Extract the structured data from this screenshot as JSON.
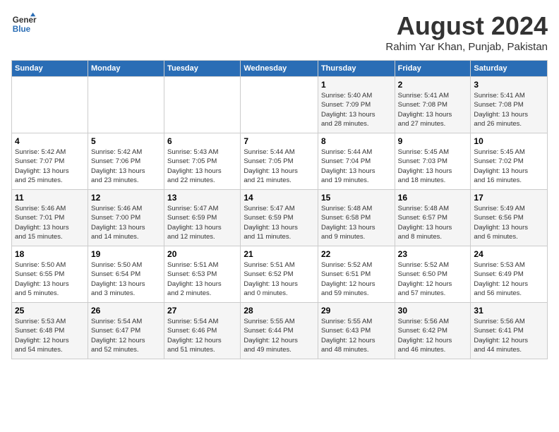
{
  "header": {
    "logo_line1": "General",
    "logo_line2": "Blue",
    "month_year": "August 2024",
    "location": "Rahim Yar Khan, Punjab, Pakistan"
  },
  "weekdays": [
    "Sunday",
    "Monday",
    "Tuesday",
    "Wednesday",
    "Thursday",
    "Friday",
    "Saturday"
  ],
  "weeks": [
    [
      {
        "day": "",
        "info": ""
      },
      {
        "day": "",
        "info": ""
      },
      {
        "day": "",
        "info": ""
      },
      {
        "day": "",
        "info": ""
      },
      {
        "day": "1",
        "info": "Sunrise: 5:40 AM\nSunset: 7:09 PM\nDaylight: 13 hours\nand 28 minutes."
      },
      {
        "day": "2",
        "info": "Sunrise: 5:41 AM\nSunset: 7:08 PM\nDaylight: 13 hours\nand 27 minutes."
      },
      {
        "day": "3",
        "info": "Sunrise: 5:41 AM\nSunset: 7:08 PM\nDaylight: 13 hours\nand 26 minutes."
      }
    ],
    [
      {
        "day": "4",
        "info": "Sunrise: 5:42 AM\nSunset: 7:07 PM\nDaylight: 13 hours\nand 25 minutes."
      },
      {
        "day": "5",
        "info": "Sunrise: 5:42 AM\nSunset: 7:06 PM\nDaylight: 13 hours\nand 23 minutes."
      },
      {
        "day": "6",
        "info": "Sunrise: 5:43 AM\nSunset: 7:05 PM\nDaylight: 13 hours\nand 22 minutes."
      },
      {
        "day": "7",
        "info": "Sunrise: 5:44 AM\nSunset: 7:05 PM\nDaylight: 13 hours\nand 21 minutes."
      },
      {
        "day": "8",
        "info": "Sunrise: 5:44 AM\nSunset: 7:04 PM\nDaylight: 13 hours\nand 19 minutes."
      },
      {
        "day": "9",
        "info": "Sunrise: 5:45 AM\nSunset: 7:03 PM\nDaylight: 13 hours\nand 18 minutes."
      },
      {
        "day": "10",
        "info": "Sunrise: 5:45 AM\nSunset: 7:02 PM\nDaylight: 13 hours\nand 16 minutes."
      }
    ],
    [
      {
        "day": "11",
        "info": "Sunrise: 5:46 AM\nSunset: 7:01 PM\nDaylight: 13 hours\nand 15 minutes."
      },
      {
        "day": "12",
        "info": "Sunrise: 5:46 AM\nSunset: 7:00 PM\nDaylight: 13 hours\nand 14 minutes."
      },
      {
        "day": "13",
        "info": "Sunrise: 5:47 AM\nSunset: 6:59 PM\nDaylight: 13 hours\nand 12 minutes."
      },
      {
        "day": "14",
        "info": "Sunrise: 5:47 AM\nSunset: 6:59 PM\nDaylight: 13 hours\nand 11 minutes."
      },
      {
        "day": "15",
        "info": "Sunrise: 5:48 AM\nSunset: 6:58 PM\nDaylight: 13 hours\nand 9 minutes."
      },
      {
        "day": "16",
        "info": "Sunrise: 5:48 AM\nSunset: 6:57 PM\nDaylight: 13 hours\nand 8 minutes."
      },
      {
        "day": "17",
        "info": "Sunrise: 5:49 AM\nSunset: 6:56 PM\nDaylight: 13 hours\nand 6 minutes."
      }
    ],
    [
      {
        "day": "18",
        "info": "Sunrise: 5:50 AM\nSunset: 6:55 PM\nDaylight: 13 hours\nand 5 minutes."
      },
      {
        "day": "19",
        "info": "Sunrise: 5:50 AM\nSunset: 6:54 PM\nDaylight: 13 hours\nand 3 minutes."
      },
      {
        "day": "20",
        "info": "Sunrise: 5:51 AM\nSunset: 6:53 PM\nDaylight: 13 hours\nand 2 minutes."
      },
      {
        "day": "21",
        "info": "Sunrise: 5:51 AM\nSunset: 6:52 PM\nDaylight: 13 hours\nand 0 minutes."
      },
      {
        "day": "22",
        "info": "Sunrise: 5:52 AM\nSunset: 6:51 PM\nDaylight: 12 hours\nand 59 minutes."
      },
      {
        "day": "23",
        "info": "Sunrise: 5:52 AM\nSunset: 6:50 PM\nDaylight: 12 hours\nand 57 minutes."
      },
      {
        "day": "24",
        "info": "Sunrise: 5:53 AM\nSunset: 6:49 PM\nDaylight: 12 hours\nand 56 minutes."
      }
    ],
    [
      {
        "day": "25",
        "info": "Sunrise: 5:53 AM\nSunset: 6:48 PM\nDaylight: 12 hours\nand 54 minutes."
      },
      {
        "day": "26",
        "info": "Sunrise: 5:54 AM\nSunset: 6:47 PM\nDaylight: 12 hours\nand 52 minutes."
      },
      {
        "day": "27",
        "info": "Sunrise: 5:54 AM\nSunset: 6:46 PM\nDaylight: 12 hours\nand 51 minutes."
      },
      {
        "day": "28",
        "info": "Sunrise: 5:55 AM\nSunset: 6:44 PM\nDaylight: 12 hours\nand 49 minutes."
      },
      {
        "day": "29",
        "info": "Sunrise: 5:55 AM\nSunset: 6:43 PM\nDaylight: 12 hours\nand 48 minutes."
      },
      {
        "day": "30",
        "info": "Sunrise: 5:56 AM\nSunset: 6:42 PM\nDaylight: 12 hours\nand 46 minutes."
      },
      {
        "day": "31",
        "info": "Sunrise: 5:56 AM\nSunset: 6:41 PM\nDaylight: 12 hours\nand 44 minutes."
      }
    ]
  ]
}
